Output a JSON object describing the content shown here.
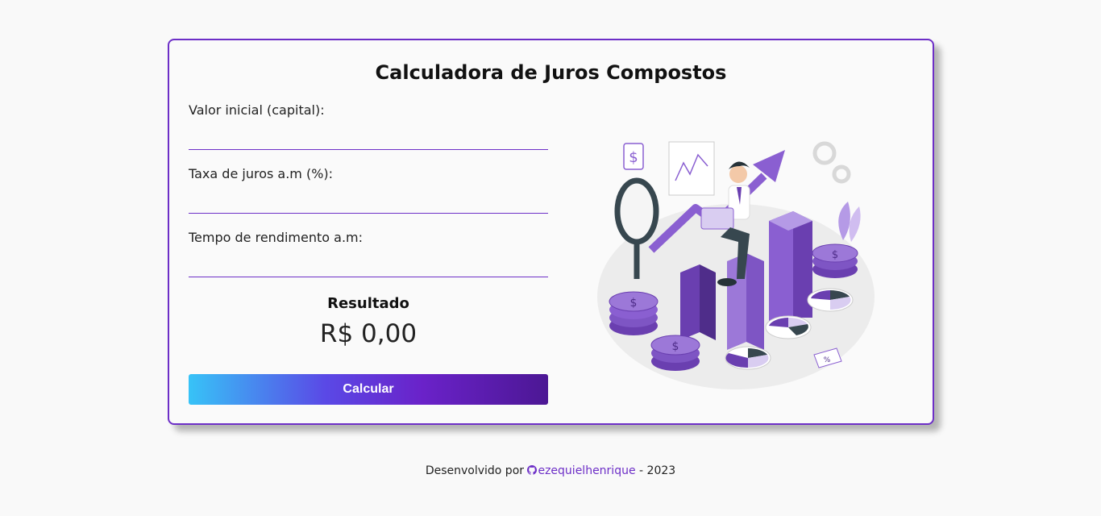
{
  "card": {
    "title": "Calculadora de Juros Compostos",
    "fields": [
      {
        "label": "Valor inicial (capital):",
        "value": ""
      },
      {
        "label": "Taxa de juros a.m (%):",
        "value": ""
      },
      {
        "label": "Tempo de rendimento a.m:",
        "value": ""
      }
    ],
    "result": {
      "title": "Resultado",
      "value": "R$ 0,00"
    },
    "button_label": "Calcular",
    "illustration_icon": "finance-growth-illustration"
  },
  "footer": {
    "prefix": "Desenvolvido por",
    "link_text": "ezequielhenrique",
    "suffix": "- 2023",
    "link_icon": "github-icon"
  },
  "colors": {
    "accent": "#6d2fc7",
    "button_gradient_start": "#37c3f7",
    "button_gradient_end": "#4c1794",
    "background": "#f9f9f9"
  }
}
